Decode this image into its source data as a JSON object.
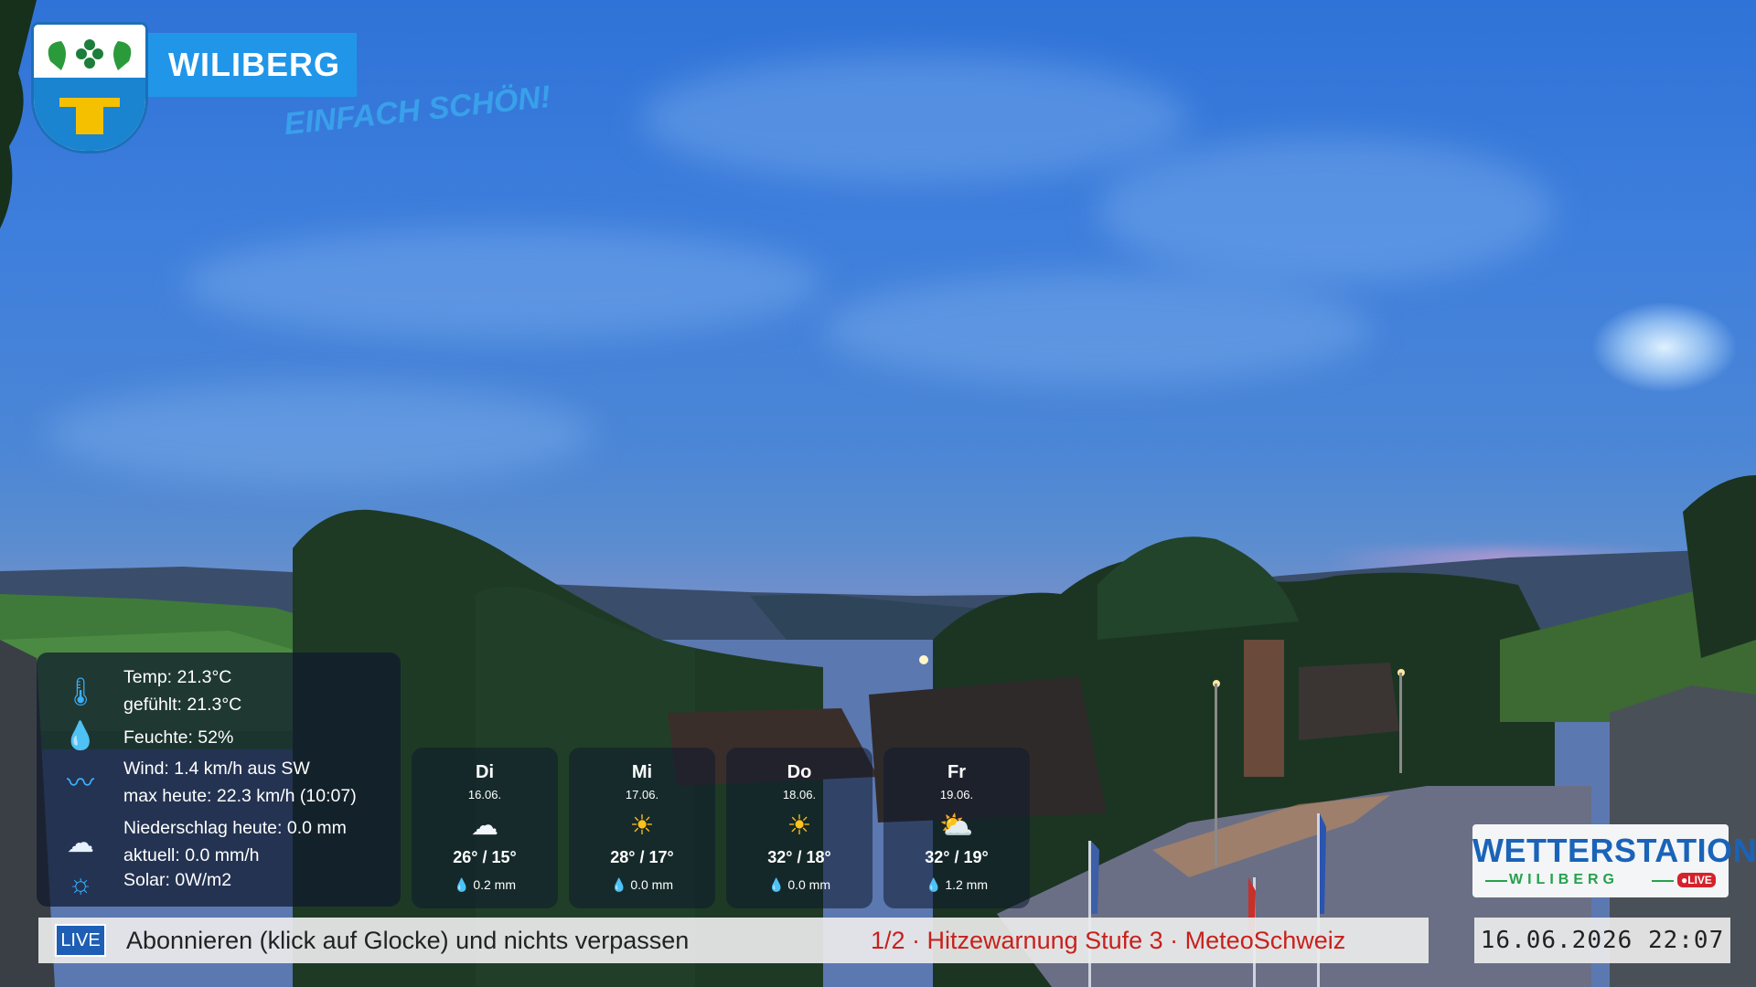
{
  "logo": {
    "brand": "WILIBERG",
    "slogan": "EINFACH SCHÖN!"
  },
  "weather": {
    "temp": "Temp: 21.3°C",
    "feels": "gefühlt: 21.3°C",
    "humidity": "Feuchte: 52%",
    "wind": "Wind: 1.4 km/h aus SW",
    "wind_max": "max heute: 22.3 km/h (10:07)",
    "rain_today": "Niederschlag heute: 0.0 mm",
    "rain_now": "aktuell: 0.0 mm/h",
    "solar": "Solar: 0W/m2"
  },
  "forecast": [
    {
      "day": "Di",
      "date": "16.06.",
      "icon": "cloud-icon",
      "temp": "26° / 15°",
      "rain": "0.2 mm"
    },
    {
      "day": "Mi",
      "date": "17.06.",
      "icon": "sun-icon",
      "temp": "28° / 17°",
      "rain": "0.0 mm"
    },
    {
      "day": "Do",
      "date": "18.06.",
      "icon": "sun-icon",
      "temp": "32° / 18°",
      "rain": "0.0 mm"
    },
    {
      "day": "Fr",
      "date": "19.06.",
      "icon": "sun-cloud-icon",
      "temp": "32° / 19°",
      "rain": "1.2 mm"
    }
  ],
  "ticker": {
    "live": "LIVE",
    "message": "Abonnieren (klick auf Glocke) und nichts verpassen",
    "alert": "1/2 · Hitzewarnung Stufe 3 · MeteoSchweiz"
  },
  "clock": "16.06.2026  22:07",
  "station": {
    "title": "WETTERSTATION",
    "subtitle": "WILIBERG",
    "live": "●LIVE"
  }
}
